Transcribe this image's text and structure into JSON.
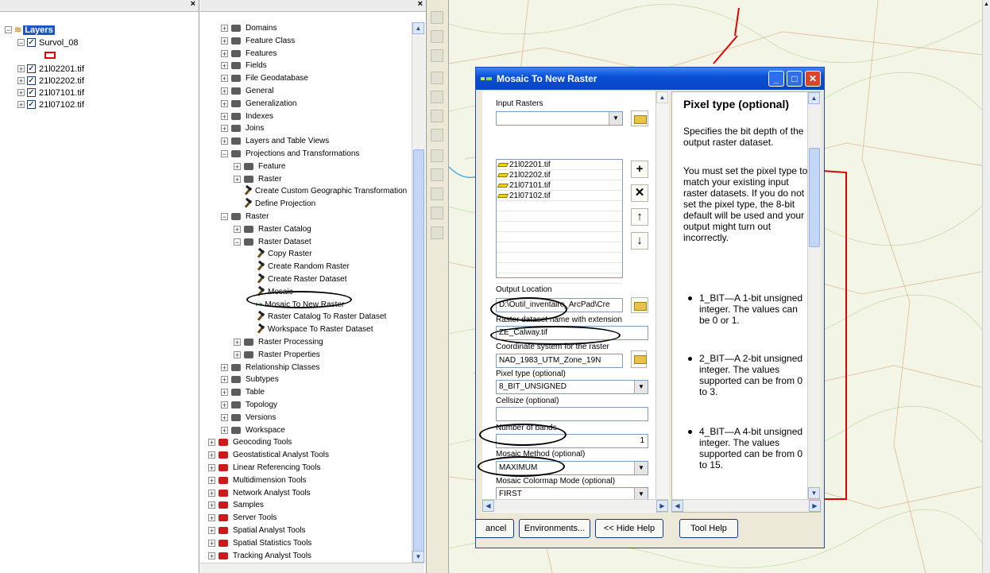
{
  "toc": {
    "root_label": "Layers",
    "group_label": "Survol_08",
    "layers": [
      "21l02201.tif",
      "21l02202.tif",
      "21l07101.tif",
      "21l07102.tif"
    ]
  },
  "toolbox": {
    "items": [
      {
        "label": "Domains",
        "indent": 0,
        "type": "toolbox",
        "exp": "+"
      },
      {
        "label": "Feature Class",
        "indent": 0,
        "type": "toolbox",
        "exp": "+"
      },
      {
        "label": "Features",
        "indent": 0,
        "type": "toolbox",
        "exp": "+"
      },
      {
        "label": "Fields",
        "indent": 0,
        "type": "toolbox",
        "exp": "+"
      },
      {
        "label": "File Geodatabase",
        "indent": 0,
        "type": "toolbox",
        "exp": "+"
      },
      {
        "label": "General",
        "indent": 0,
        "type": "toolbox",
        "exp": "+"
      },
      {
        "label": "Generalization",
        "indent": 0,
        "type": "toolbox",
        "exp": "+"
      },
      {
        "label": "Indexes",
        "indent": 0,
        "type": "toolbox",
        "exp": "+"
      },
      {
        "label": "Joins",
        "indent": 0,
        "type": "toolbox",
        "exp": "+"
      },
      {
        "label": "Layers and Table Views",
        "indent": 0,
        "type": "toolbox",
        "exp": "+"
      },
      {
        "label": "Projections and Transformations",
        "indent": 0,
        "type": "toolbox",
        "exp": "−"
      },
      {
        "label": "Feature",
        "indent": 1,
        "type": "toolbox",
        "exp": "+"
      },
      {
        "label": "Raster",
        "indent": 1,
        "type": "toolbox",
        "exp": "+"
      },
      {
        "label": "Create Custom Geographic Transformation",
        "indent": 1,
        "type": "tool",
        "exp": ""
      },
      {
        "label": "Define Projection",
        "indent": 1,
        "type": "tool",
        "exp": ""
      },
      {
        "label": "Raster",
        "indent": 0,
        "type": "toolbox",
        "exp": "−"
      },
      {
        "label": "Raster Catalog",
        "indent": 1,
        "type": "toolbox",
        "exp": "+"
      },
      {
        "label": "Raster Dataset",
        "indent": 1,
        "type": "toolbox",
        "exp": "−"
      },
      {
        "label": "Copy Raster",
        "indent": 2,
        "type": "tool",
        "exp": ""
      },
      {
        "label": "Create Random Raster",
        "indent": 2,
        "type": "tool",
        "exp": ""
      },
      {
        "label": "Create Raster Dataset",
        "indent": 2,
        "type": "tool",
        "exp": ""
      },
      {
        "label": "Mosaic",
        "indent": 2,
        "type": "tool",
        "exp": ""
      },
      {
        "label": "Mosaic To New Raster",
        "indent": 2,
        "type": "script",
        "exp": ""
      },
      {
        "label": "Raster Catalog To Raster Dataset",
        "indent": 2,
        "type": "tool",
        "exp": ""
      },
      {
        "label": "Workspace To Raster Dataset",
        "indent": 2,
        "type": "tool",
        "exp": ""
      },
      {
        "label": "Raster Processing",
        "indent": 1,
        "type": "toolbox",
        "exp": "+"
      },
      {
        "label": "Raster Properties",
        "indent": 1,
        "type": "toolbox",
        "exp": "+"
      },
      {
        "label": "Relationship Classes",
        "indent": 0,
        "type": "toolbox",
        "exp": "+"
      },
      {
        "label": "Subtypes",
        "indent": 0,
        "type": "toolbox",
        "exp": "+"
      },
      {
        "label": "Table",
        "indent": 0,
        "type": "toolbox",
        "exp": "+"
      },
      {
        "label": "Topology",
        "indent": 0,
        "type": "toolbox",
        "exp": "+"
      },
      {
        "label": "Versions",
        "indent": 0,
        "type": "toolbox",
        "exp": "+"
      },
      {
        "label": "Workspace",
        "indent": 0,
        "type": "toolbox",
        "exp": "+"
      },
      {
        "label": "Geocoding Tools",
        "indent": -1,
        "type": "redbox",
        "exp": "+"
      },
      {
        "label": "Geostatistical Analyst Tools",
        "indent": -1,
        "type": "redbox",
        "exp": "+"
      },
      {
        "label": "Linear Referencing Tools",
        "indent": -1,
        "type": "redbox",
        "exp": "+"
      },
      {
        "label": "Multidimension Tools",
        "indent": -1,
        "type": "redbox",
        "exp": "+"
      },
      {
        "label": "Network Analyst Tools",
        "indent": -1,
        "type": "redbox",
        "exp": "+"
      },
      {
        "label": "Samples",
        "indent": -1,
        "type": "redbox",
        "exp": "+"
      },
      {
        "label": "Server Tools",
        "indent": -1,
        "type": "redbox",
        "exp": "+"
      },
      {
        "label": "Spatial Analyst Tools",
        "indent": -1,
        "type": "redbox",
        "exp": "+"
      },
      {
        "label": "Spatial Statistics Tools",
        "indent": -1,
        "type": "redbox",
        "exp": "+"
      },
      {
        "label": "Tracking Analyst Tools",
        "indent": -1,
        "type": "redbox",
        "exp": "+"
      }
    ]
  },
  "dialog": {
    "title": "Mosaic To New Raster",
    "input_rasters_label": "Input Rasters",
    "input_rasters": [
      "21l02201.tif",
      "21l02202.tif",
      "21l07101.tif",
      "21l07102.tif"
    ],
    "output_location_label": "Output Location",
    "output_location_value": "D:\\Outil_inventaire_ArcPad\\Cre",
    "dataset_name_label": "Raster dataset name with extension",
    "dataset_name_value": "ZE_Calway.tif",
    "coord_label": "Coordinate system for the raster",
    "coord_value": "NAD_1983_UTM_Zone_19N",
    "pixel_type_label": "Pixel type (optional)",
    "pixel_type_value": "8_BIT_UNSIGNED",
    "cellsize_label": "Cellsize (optional)",
    "cellsize_value": "",
    "bands_label": "Number of bands",
    "bands_value": "1",
    "mosaic_method_label": "Mosaic Method (optional)",
    "mosaic_method_value": "MAXIMUM",
    "colormap_label": "Mosaic Colormap Mode (optional)",
    "colormap_value": "FIRST",
    "buttons": {
      "cancel": "ancel",
      "environments": "Environments...",
      "hide_help": "<< Hide Help",
      "tool_help": "Tool Help"
    }
  },
  "help": {
    "title": "Pixel type (optional)",
    "para1": "Specifies the bit depth of the output raster dataset.",
    "para2": "You must set the pixel type to match your existing input raster datasets. If you do not set the pixel type, the 8-bit default will be used and your output might turn out incorrectly.",
    "bullets": [
      "1_BIT—A 1-bit unsigned integer. The values can be 0 or 1.",
      "2_BIT—A 2-bit unsigned integer. The values supported can be from 0 to 3.",
      "4_BIT—A 4-bit unsigned integer. The values supported can be from 0 to 15."
    ]
  },
  "colors": {
    "selection": "#1e56c9",
    "titlebar": "#0a4fd7",
    "dialog_bg": "#ece9d8",
    "map_bg": "#f3f6e6",
    "boundary": "#e00000"
  }
}
